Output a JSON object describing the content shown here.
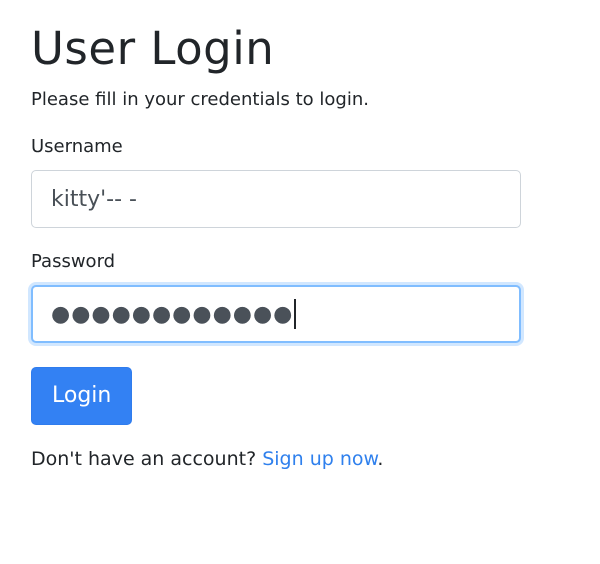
{
  "page": {
    "title": "User Login",
    "subtitle": "Please fill in your credentials to login."
  },
  "form": {
    "username_label": "Username",
    "username_value": "kitty'-- -",
    "password_label": "Password",
    "password_mask": "●●●●●●●●●●●●",
    "submit_label": "Login"
  },
  "footer": {
    "prompt": "Don't have an account? ",
    "link_text": "Sign up now",
    "suffix": "."
  },
  "colors": {
    "primary": "#3381f3",
    "link": "#2f80ed",
    "focus_border": "#80bdff"
  }
}
